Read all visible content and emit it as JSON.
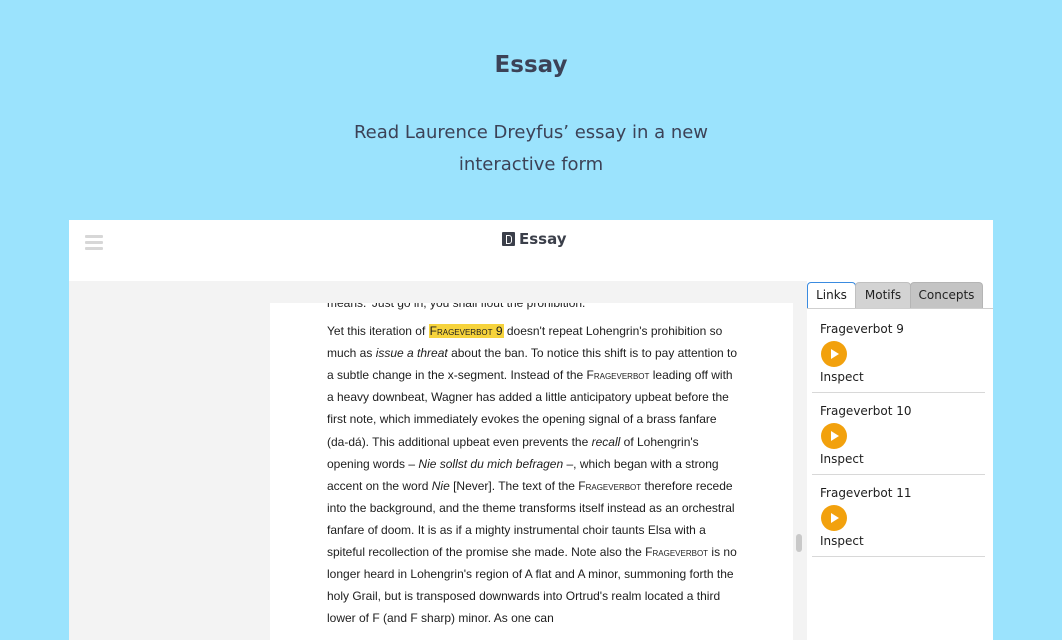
{
  "hero": {
    "title": "Essay",
    "subtitle": "Read Laurence Dreyfus’ essay in a new interactive form"
  },
  "app": {
    "title": "Essay",
    "menu_icon": "hamburger-menu-icon",
    "doc_icon": "document-icon"
  },
  "article": {
    "prev_line_fragment": "means.’ Just go in, you shall flout the prohibition.",
    "paragraph_runs": [
      {
        "text": "Yet this iteration of ",
        "style": "normal"
      },
      {
        "text": "Frageverbot 9",
        "style": "highlight-sc"
      },
      {
        "text": " doesn't repeat Lohengrin's prohibition so much as ",
        "style": "normal"
      },
      {
        "text": "issue a threat",
        "style": "italic"
      },
      {
        "text": " about the ban. To notice this shift is to pay attention to a subtle change in the x-segment. Instead of the ",
        "style": "normal"
      },
      {
        "text": "Frageverbot",
        "style": "sc"
      },
      {
        "text": " leading off with a heavy downbeat, Wagner has added a little anticipatory upbeat before the first note, which immediately evokes the opening signal of a brass fanfare (da-dá). This additional upbeat even prevents the ",
        "style": "normal"
      },
      {
        "text": "recall",
        "style": "italic"
      },
      {
        "text": " of Lohengrin's opening words – ",
        "style": "normal"
      },
      {
        "text": "Nie sollst du mich befragen",
        "style": "italic"
      },
      {
        "text": " –, which began with a strong accent on the word ",
        "style": "normal"
      },
      {
        "text": "Nie",
        "style": "italic"
      },
      {
        "text": " [Never]. The text of the ",
        "style": "normal"
      },
      {
        "text": "Frageverbot",
        "style": "sc"
      },
      {
        "text": " therefore recede into the background, and the theme transforms itself instead as an orchestral fanfare of doom. It is as if a mighty instrumental choir taunts Elsa with a spiteful recollection of the promise she made. Note also the ",
        "style": "normal"
      },
      {
        "text": "Frageverbot",
        "style": "sc"
      },
      {
        "text": " is no longer heard in Lohengrin's region of A flat and A minor, summoning forth the holy Grail, but is transposed downwards into Ortrud's realm located a third lower of F (and F sharp) minor. As one can",
        "style": "normal"
      }
    ]
  },
  "side_panel": {
    "tabs": [
      {
        "label": "Links",
        "active": true
      },
      {
        "label": "Motifs",
        "active": false
      },
      {
        "label": "Concepts",
        "active": false
      }
    ],
    "links": [
      {
        "title": "Frageverbot 9",
        "action": "Inspect",
        "icon": "play-icon"
      },
      {
        "title": "Frageverbot 10",
        "action": "Inspect",
        "icon": "play-icon"
      },
      {
        "title": "Frageverbot 11",
        "action": "Inspect",
        "icon": "play-icon"
      }
    ]
  },
  "colors": {
    "page_background": "#9be3fd",
    "highlight": "#f6d33c",
    "play_button": "#f2a10d",
    "active_tab_border": "#3a8be0"
  }
}
